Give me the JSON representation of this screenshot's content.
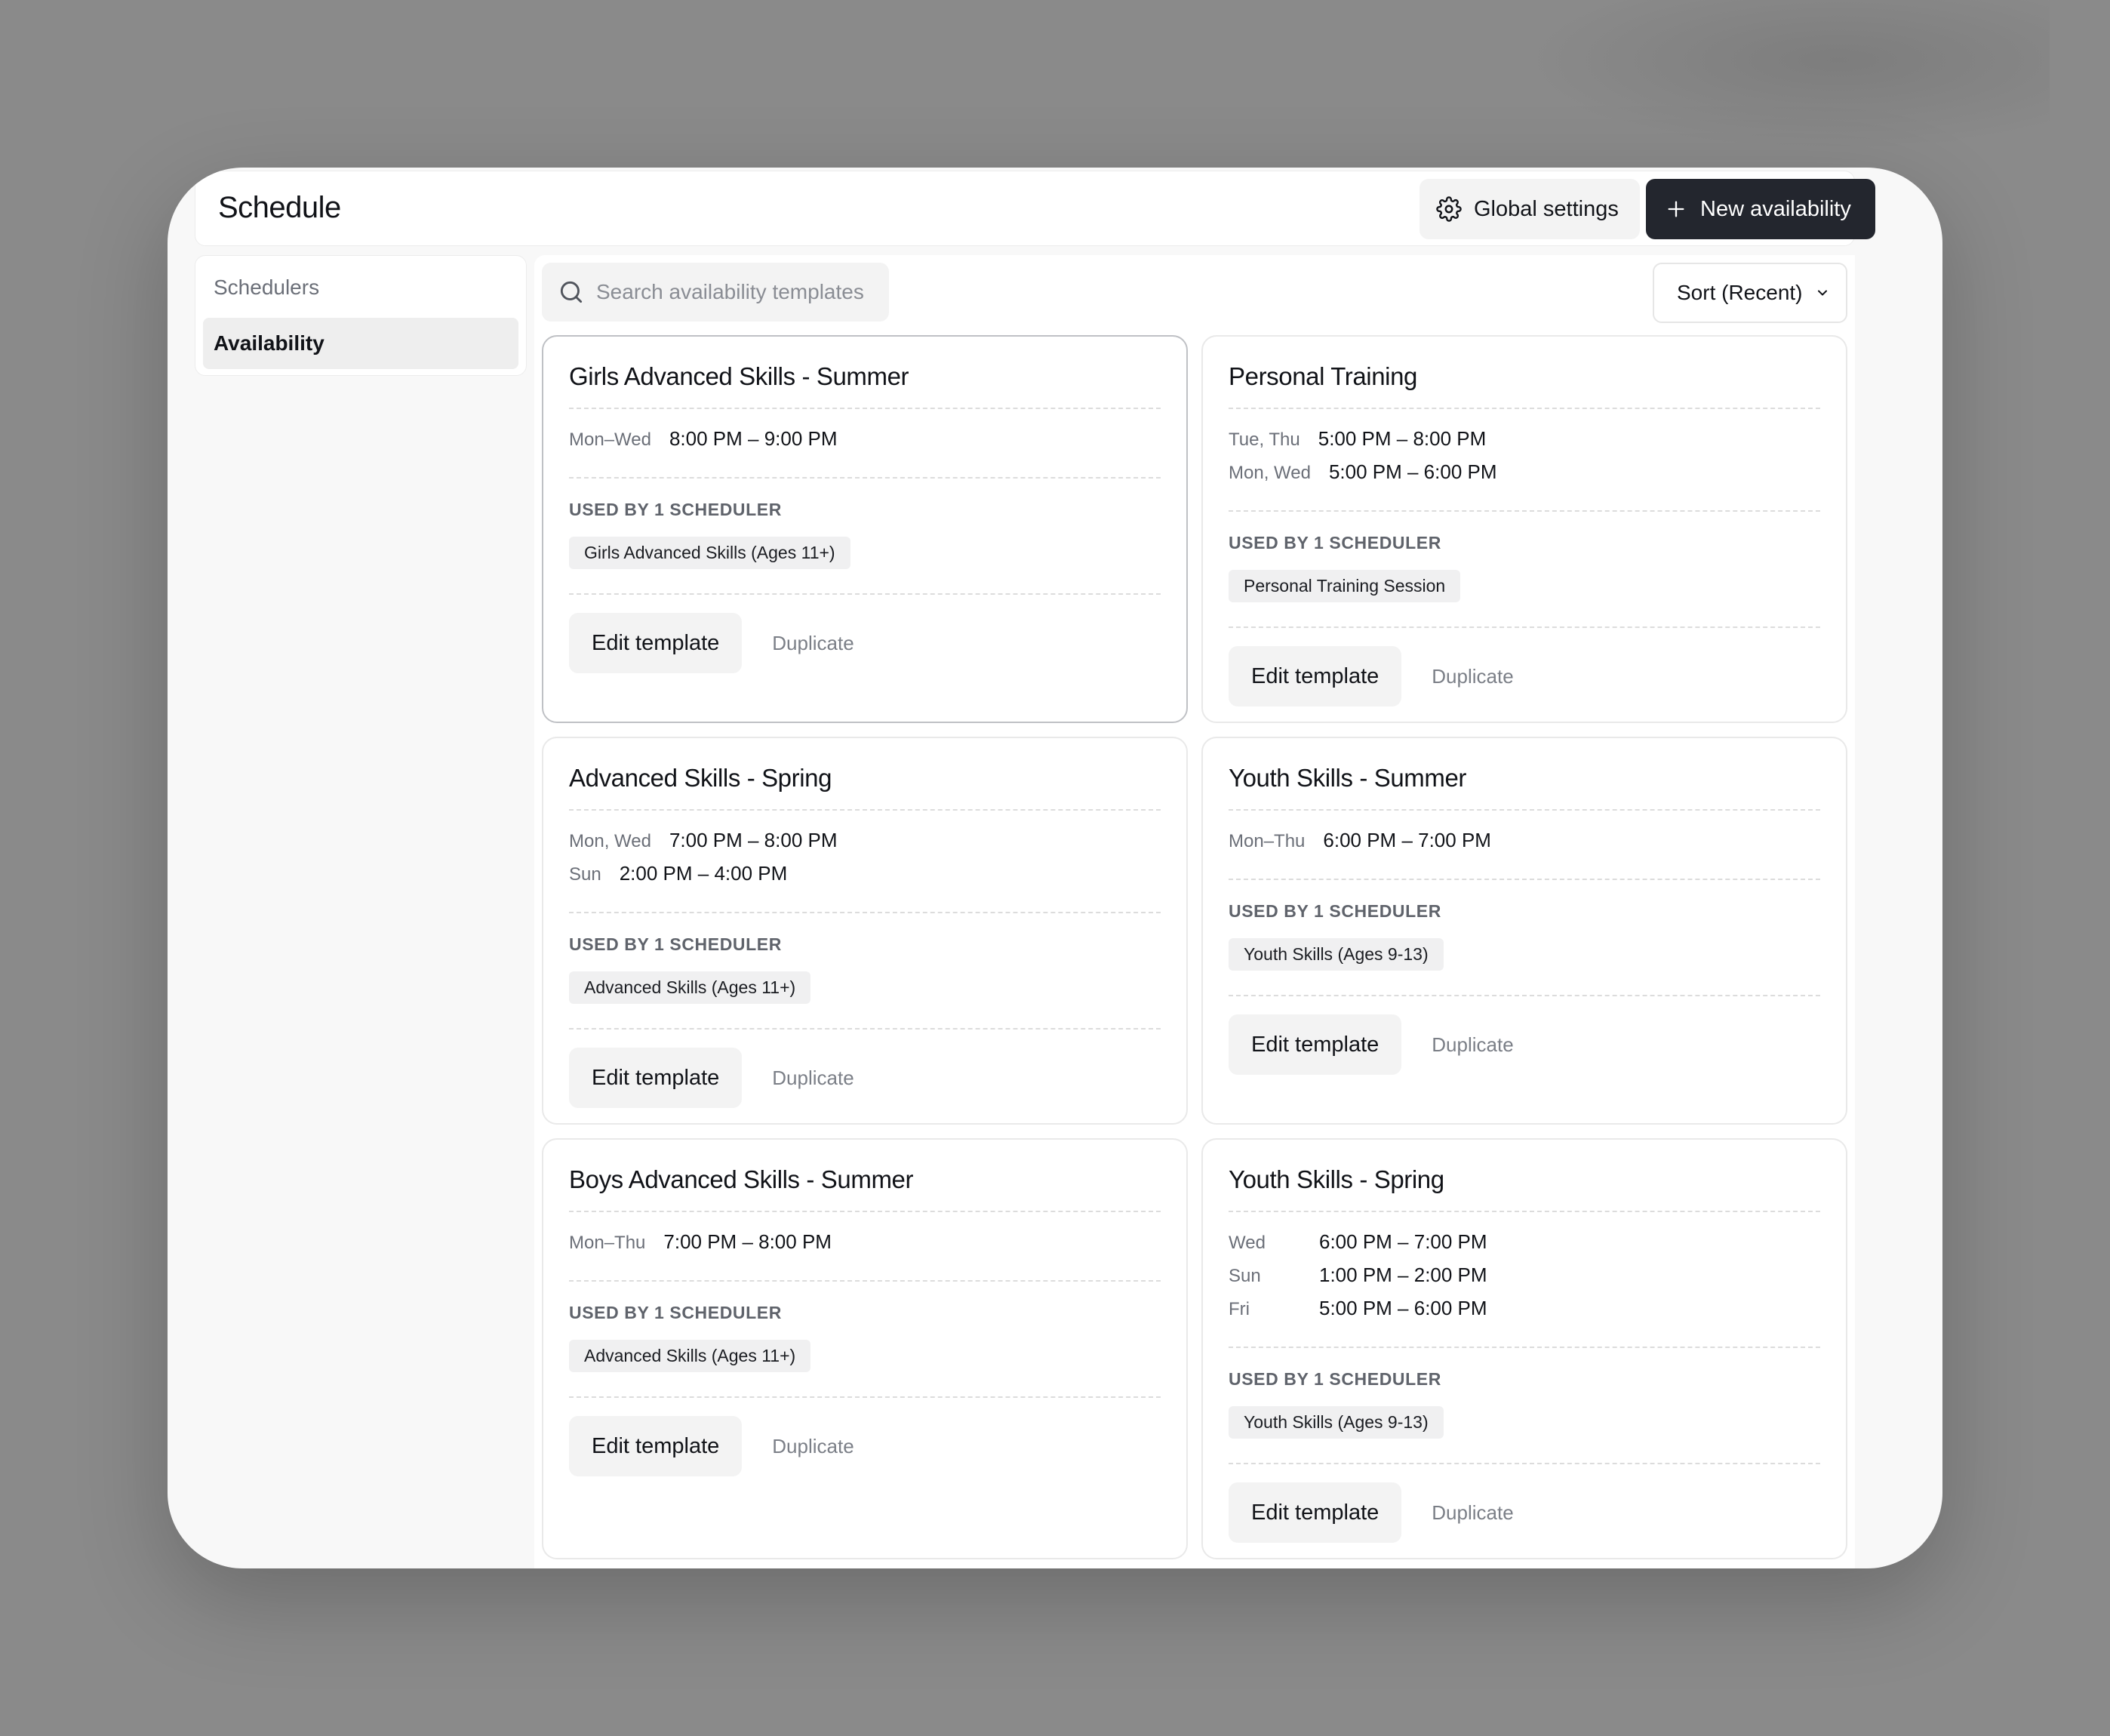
{
  "header": {
    "title": "Schedule",
    "global_settings_label": "Global settings",
    "new_availability_label": "New availability"
  },
  "sidebar": {
    "heading": "Schedulers",
    "items": [
      {
        "label": "Availability",
        "active": true
      }
    ]
  },
  "toolbar": {
    "search_placeholder": "Search availability templates",
    "sort_label": "Sort (Recent)"
  },
  "cards": [
    {
      "title": "Girls Advanced Skills - Summer",
      "schedule": [
        {
          "days": "Mon–Wed",
          "time": "8:00 PM – 9:00 PM"
        }
      ],
      "used_by": "USED BY 1 SCHEDULER",
      "tags": [
        "Girls Advanced Skills (Ages 11+)"
      ],
      "edit_label": "Edit template",
      "duplicate_label": "Duplicate"
    },
    {
      "title": "Personal Training",
      "schedule": [
        {
          "days": "Tue, Thu",
          "time": "5:00 PM – 8:00 PM"
        },
        {
          "days": "Mon, Wed",
          "time": "5:00 PM – 6:00 PM"
        }
      ],
      "used_by": "USED BY 1 SCHEDULER",
      "tags": [
        "Personal Training Session"
      ],
      "edit_label": "Edit template",
      "duplicate_label": "Duplicate"
    },
    {
      "title": "Advanced Skills - Spring",
      "schedule": [
        {
          "days": "Mon, Wed",
          "time": "7:00 PM – 8:00 PM"
        },
        {
          "days": "Sun",
          "time": "2:00 PM – 4:00 PM"
        }
      ],
      "used_by": "USED BY 1 SCHEDULER",
      "tags": [
        "Advanced Skills (Ages 11+)"
      ],
      "edit_label": "Edit template",
      "duplicate_label": "Duplicate"
    },
    {
      "title": "Youth Skills - Summer",
      "schedule": [
        {
          "days": "Mon–Thu",
          "time": "6:00 PM – 7:00 PM"
        }
      ],
      "used_by": "USED BY 1 SCHEDULER",
      "tags": [
        "Youth Skills (Ages 9-13)"
      ],
      "edit_label": "Edit template",
      "duplicate_label": "Duplicate"
    },
    {
      "title": "Boys Advanced Skills - Summer",
      "schedule": [
        {
          "days": "Mon–Thu",
          "time": "7:00 PM – 8:00 PM"
        }
      ],
      "used_by": "USED BY 1 SCHEDULER",
      "tags": [
        "Advanced Skills (Ages 11+)"
      ],
      "edit_label": "Edit template",
      "duplicate_label": "Duplicate"
    },
    {
      "title": "Youth Skills - Spring",
      "schedule": [
        {
          "days": "Wed",
          "time": "6:00 PM – 7:00 PM"
        },
        {
          "days": "Sun",
          "time": "1:00 PM – 2:00 PM"
        },
        {
          "days": "Fri",
          "time": "5:00 PM – 6:00 PM"
        }
      ],
      "used_by": "USED BY 1 SCHEDULER",
      "tags": [
        "Youth Skills (Ages 9-13)"
      ],
      "edit_label": "Edit template",
      "duplicate_label": "Duplicate"
    }
  ]
}
